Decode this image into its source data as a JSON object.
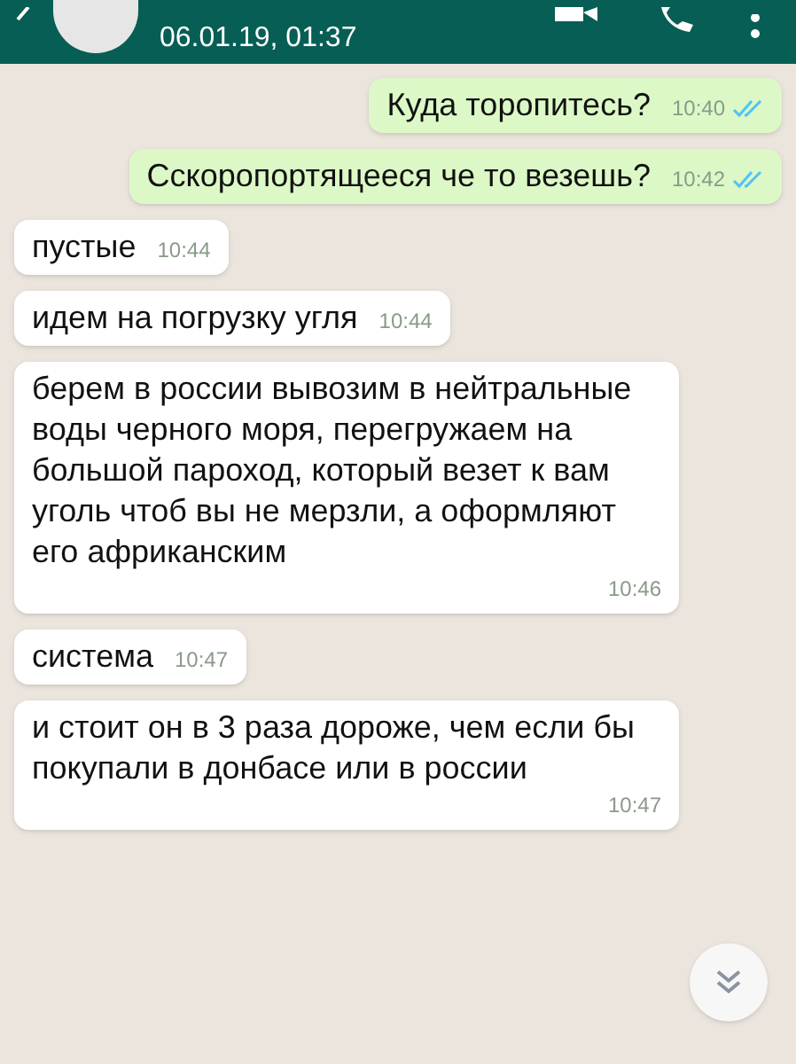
{
  "header": {
    "subtitle": "06.01.19, 01:37"
  },
  "messages": [
    {
      "kind": "outgoing",
      "text": "Куда торопитесь?",
      "time": "10:40",
      "read": true
    },
    {
      "kind": "outgoing",
      "text": "Сскоропортящееся че то везешь?",
      "time": "10:42",
      "read": true
    },
    {
      "kind": "incoming",
      "text": "пустые",
      "time": "10:44"
    },
    {
      "kind": "incoming",
      "text": "идем на погрузку угля",
      "time": "10:44"
    },
    {
      "kind": "incoming",
      "text": "берем в россии вывозим в нейтральные воды черного моря, перегружаем на большой пароход, который везет к вам уголь чтоб вы не мерзли, а оформляют его африканским",
      "time": "10:46"
    },
    {
      "kind": "incoming",
      "text": "система",
      "time": "10:47"
    },
    {
      "kind": "incoming",
      "text": "и стоит он в 3 раза дороже, чем если бы покупали в донбасе или в россии",
      "time": "10:47"
    }
  ]
}
